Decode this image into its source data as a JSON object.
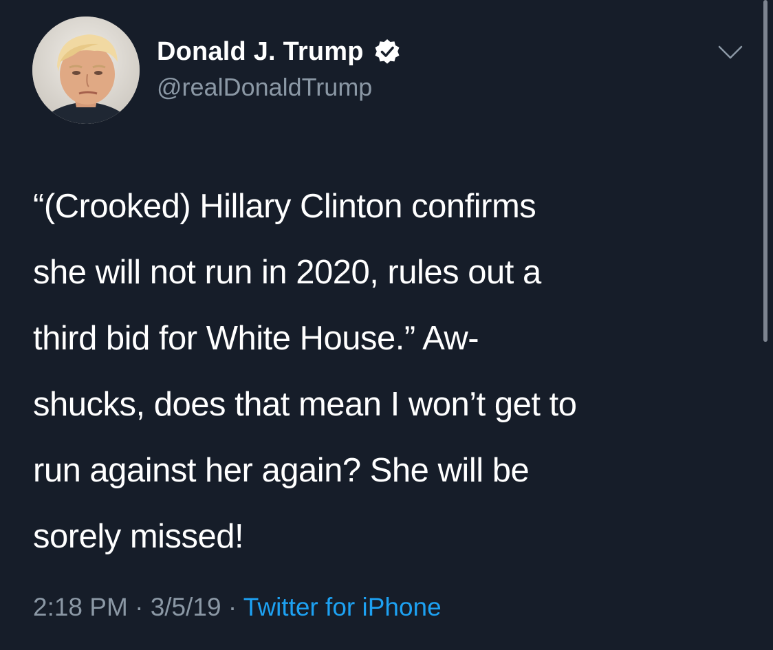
{
  "author": {
    "display_name": "Donald J. Trump",
    "handle": "@realDonaldTrump",
    "verified": true,
    "avatar_icon": "profile-photo"
  },
  "tweet": {
    "lines": [
      "“(Crooked) Hillary Clinton confirms",
      "she will not run in 2020, rules out a",
      "third bid for White House.” Aw-",
      "shucks, does that mean I won’t get to",
      "run against her again? She will be",
      "sorely missed!"
    ]
  },
  "meta": {
    "time": "2:18 PM",
    "separator": "·",
    "date": "3/5/19",
    "source": "Twitter for iPhone"
  },
  "icons": {
    "verified": "verified-badge-icon",
    "menu": "chevron-down-icon"
  },
  "colors": {
    "background": "#161d29",
    "secondary_text": "#8b98a5",
    "link": "#1da1f2"
  }
}
